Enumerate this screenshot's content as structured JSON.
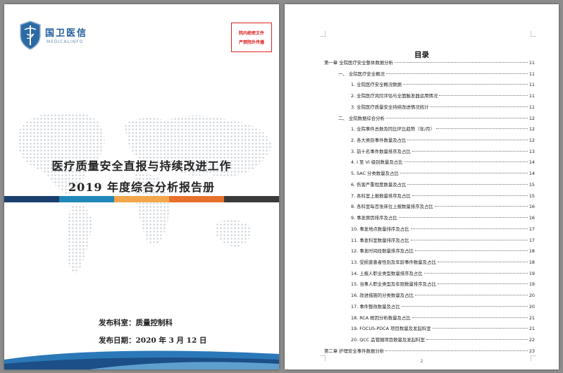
{
  "cover": {
    "logo_text": "国卫医信",
    "logo_sub": "MEDICALINFO",
    "stamp_lines": [
      "院内绝密文件",
      "严禁院外传播"
    ],
    "title_line1": "医疗质量安全直报与持续改进工作",
    "title_line2": "2019 年度综合分析报告册",
    "publisher": "发布科室：质量控制科",
    "publish_date": "发布日期：2020 年 3 月 12 日",
    "strip_colors": [
      "#1a3f6e",
      "#1f88b8",
      "#f4a64a",
      "#e8702a",
      "#3a3a3a"
    ]
  },
  "toc": {
    "title": "目录",
    "page_number": "2",
    "entries": [
      {
        "level": 0,
        "label": "第一章  全院医疗安全整体数据分析",
        "page": "11"
      },
      {
        "level": 1,
        "label": "一、  全院医疗安全概况",
        "page": "11"
      },
      {
        "level": 2,
        "label": "1. 全院医疗安全概况数据",
        "page": "11"
      },
      {
        "level": 2,
        "label": "2. 全院医疗风险评估与全面触发器运用情况",
        "page": "11"
      },
      {
        "level": 2,
        "label": "3. 全院医疗质量安全持续改进情况统计",
        "page": "11"
      },
      {
        "level": 1,
        "label": "二、  全院数据综合分析",
        "page": "12"
      },
      {
        "level": 2,
        "label": "1. 全院事件总数及同比环比趋势（年/月）",
        "page": "12"
      },
      {
        "level": 2,
        "label": "2. 各大类别事件数量及占比",
        "page": "12"
      },
      {
        "level": 2,
        "label": "3. 前十名事件数量排序及占比",
        "page": "13"
      },
      {
        "level": 2,
        "label": "4. I 至 VI 级别数量及占比",
        "page": "14"
      },
      {
        "level": 2,
        "label": "5. SAC 分类数量及占比",
        "page": "14"
      },
      {
        "level": 2,
        "label": "6. 伤害严重程度数量及占比",
        "page": "15"
      },
      {
        "level": 2,
        "label": "7. 各科室上报数量排序及占比",
        "page": "15"
      },
      {
        "level": 2,
        "label": "8. 各科室每百张床位上报数量排序及占比",
        "page": "16"
      },
      {
        "level": 2,
        "label": "9. 事发原因排序及占比",
        "page": "16"
      },
      {
        "level": 2,
        "label": "10. 事发地点数量排序及占比",
        "page": "17"
      },
      {
        "level": 2,
        "label": "11. 事发科室数量排序及占比",
        "page": "17"
      },
      {
        "level": 2,
        "label": "12. 事发时间段数量排序及占比",
        "page": "18"
      },
      {
        "level": 2,
        "label": "13. 受损害患者性别及年龄事件数量及占比",
        "page": "18"
      },
      {
        "level": 2,
        "label": "14. 上报人职业类型数量排序及占比",
        "page": "19"
      },
      {
        "level": 2,
        "label": "15. 当事人职业类型及年限数量排序及占比",
        "page": "19"
      },
      {
        "level": 2,
        "label": "16. 改进措施的分类数量及占比",
        "page": "20"
      },
      {
        "level": 2,
        "label": "17. 事件整改数量及占比",
        "page": "20"
      },
      {
        "level": 2,
        "label": "18. RCA 根因分析数量及占比",
        "page": "21"
      },
      {
        "level": 2,
        "label": "19. FOCUS-PDCA 项目数量及发起科室",
        "page": "21"
      },
      {
        "level": 2,
        "label": "20. QCC 品管圈项目数量及发起科室",
        "page": "22"
      },
      {
        "level": 0,
        "label": "第二章  护理安全事件数据分析",
        "page": "23"
      }
    ]
  }
}
